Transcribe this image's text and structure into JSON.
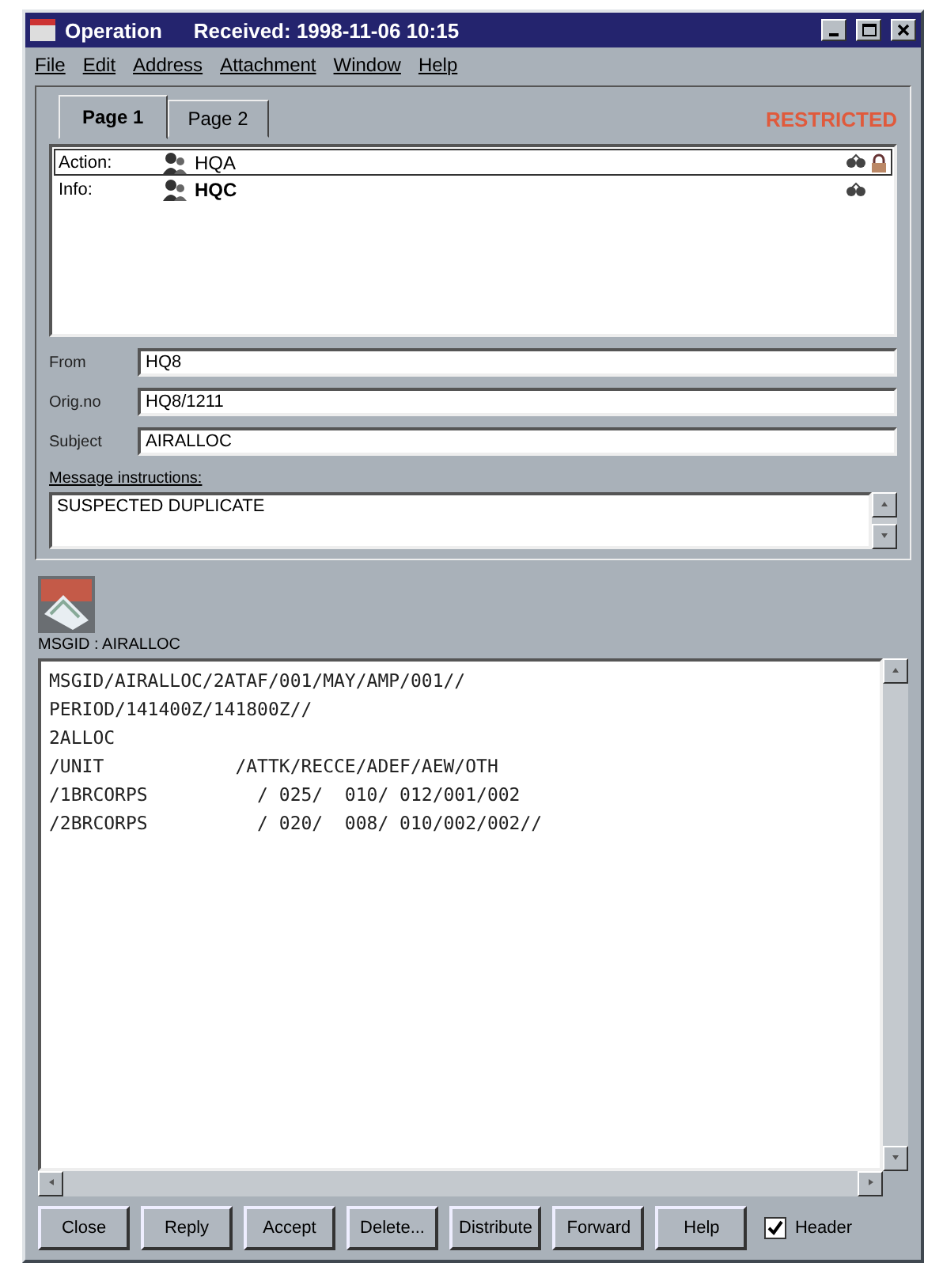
{
  "window": {
    "title": "Operation",
    "subtitle": "Received: 1998-11-06 10:15"
  },
  "menu": [
    "File",
    "Edit",
    "Address",
    "Attachment",
    "Window",
    "Help"
  ],
  "tabs": [
    {
      "label": "Page 1",
      "selected": true
    },
    {
      "label": "Page 2",
      "selected": false
    }
  ],
  "classification": "RESTRICTED",
  "recipients": [
    {
      "role": "Action:",
      "name": "HQA",
      "selected": true,
      "locked": true
    },
    {
      "role": "Info:",
      "name": "HQC",
      "selected": false,
      "locked": false
    }
  ],
  "fields": [
    {
      "label": "From",
      "value": "HQ8"
    },
    {
      "label": "Orig.no",
      "value": "HQ8/1211"
    },
    {
      "label": "Subject",
      "value": "AIRALLOC"
    }
  ],
  "instructions": {
    "label": "Message instructions:",
    "value": "SUSPECTED DUPLICATE"
  },
  "message": {
    "label": "MSGID : AIRALLOC",
    "lines": [
      "MSGID/AIRALLOC/2ATAF/001/MAY/AMP/001//",
      "PERIOD/141400Z/141800Z//",
      "2ALLOC",
      "/UNIT            /ATTK/RECCE/ADEF/AEW/OTH",
      "/1BRCORPS          / 025/  010/ 012/001/002",
      "/2BRCORPS          / 020/  008/ 010/002/002//"
    ]
  },
  "buttons": [
    "Close",
    "Reply",
    "Accept",
    "Delete...",
    "Distribute",
    "Forward",
    "Help"
  ],
  "header_option": {
    "label": "Header",
    "checked": true
  }
}
